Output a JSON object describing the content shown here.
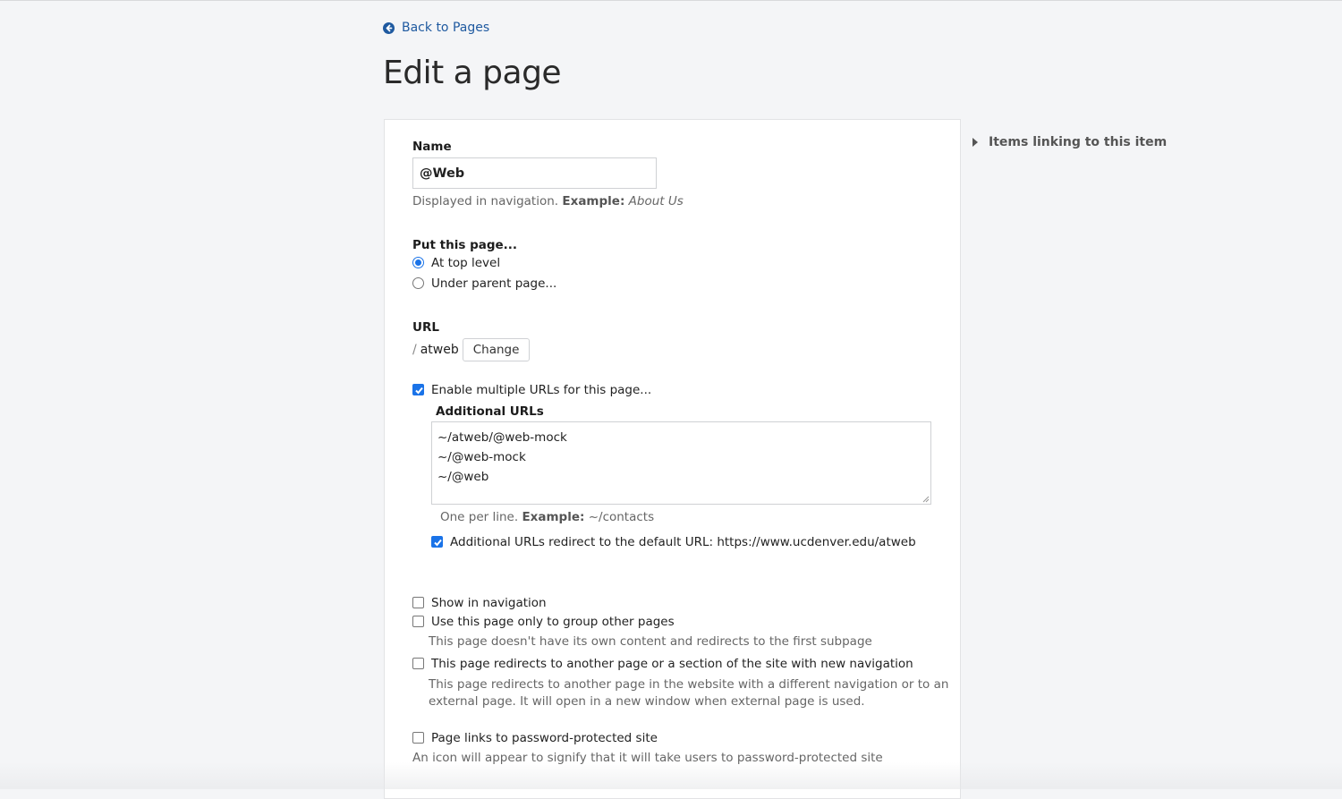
{
  "nav": {
    "back_label": "Back to Pages",
    "back_icon": "arrow-circle-left-icon"
  },
  "page_title": "Edit a page",
  "form": {
    "name": {
      "label": "Name",
      "value": "@Web",
      "help_prefix": "Displayed in navigation.",
      "help_example_label": "Example:",
      "help_example_value": "About Us"
    },
    "placement": {
      "label": "Put this page...",
      "options": [
        {
          "label": "At top level",
          "selected": true
        },
        {
          "label": "Under parent page...",
          "selected": false
        }
      ]
    },
    "url": {
      "label": "URL",
      "slash": "/",
      "value": "atweb",
      "change_label": "Change"
    },
    "multiple_urls": {
      "label": "Enable multiple URLs for this page...",
      "checked": true,
      "additional_label": "Additional URLs",
      "lines": [
        "~/atweb/@web-mock",
        "~/@web-mock",
        "~/@web"
      ],
      "help_prefix": "One per line.",
      "help_example_label": "Example:",
      "help_example_value": "~/contacts",
      "redirect_label": "Additional URLs redirect to the default URL: https://www.ucdenver.edu/atweb",
      "redirect_checked": true
    },
    "options": {
      "show_in_nav": {
        "label": "Show in navigation",
        "checked": false
      },
      "group_only": {
        "label": "Use this page only to group other pages",
        "checked": false,
        "help": "This page doesn't have its own content and redirects to the first subpage"
      },
      "redirects": {
        "label": "This page redirects to another page or a section of the site with new navigation",
        "checked": false,
        "help_line1": "This page redirects to another page in the website with a different navigation or to an",
        "help_line2": "external page. It will open in a new window when external page is used."
      },
      "password": {
        "label": "Page links to password-protected site",
        "checked": false,
        "help": "An icon will appear to signify that it will take users to password-protected site"
      }
    }
  },
  "sidebar": {
    "items_linking_label": "Items linking to this item"
  },
  "colors": {
    "accent": "#1a73e8",
    "link": "#1f5aa0"
  }
}
